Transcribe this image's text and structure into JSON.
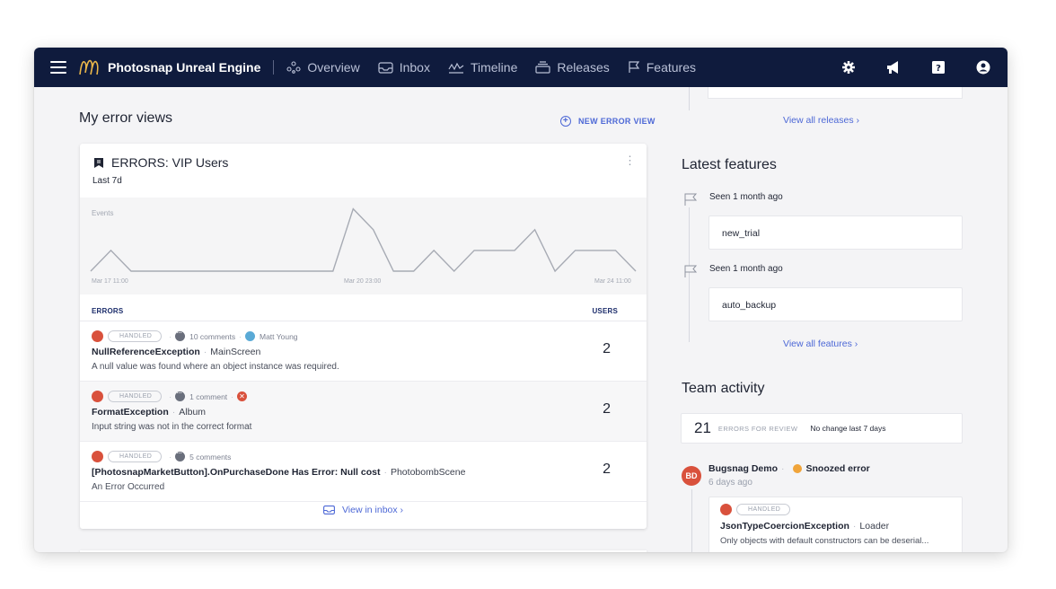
{
  "nav": {
    "project": "Photosnap Unreal Engine",
    "items": [
      {
        "label": "Overview",
        "icon": "overview-icon"
      },
      {
        "label": "Inbox",
        "icon": "inbox-icon"
      },
      {
        "label": "Timeline",
        "icon": "timeline-icon"
      },
      {
        "label": "Releases",
        "icon": "releases-icon"
      },
      {
        "label": "Features",
        "icon": "flag-icon"
      }
    ],
    "right_icons": [
      "gear-icon",
      "megaphone-icon",
      "help-icon",
      "account-icon"
    ]
  },
  "error_views": {
    "title": "My error views",
    "new_view_label": "NEW ERROR VIEW",
    "card": {
      "title": "ERRORS: VIP Users",
      "range": "Last 7d",
      "chart_label": "Events",
      "x_ticks": [
        "Mar 17 11:00",
        "Mar 20 23:00",
        "Mar 24 11:00"
      ],
      "col_errors": "ERRORS",
      "col_users": "USERS",
      "rows": [
        {
          "status": "HANDLED",
          "comments": "10 comments",
          "assignee": "Matt Young",
          "name": "NullReferenceException",
          "context": "MainScreen",
          "message": "A null value was found where an object instance was required.",
          "users": "2"
        },
        {
          "status": "HANDLED",
          "comments": "1 comment",
          "name": "FormatException",
          "context": "Album",
          "message": "Input string was not in the correct format",
          "users": "2"
        },
        {
          "status": "HANDLED",
          "comments": "5 comments",
          "name": "[PhotosnapMarketButton].OnPurchaseDone Has Error: Null cost",
          "context": "PhotobombScene",
          "message": "An Error Occurred",
          "users": "2"
        }
      ],
      "inbox_link": "View in inbox ›"
    }
  },
  "releases": {
    "view_all": "View all releases ›"
  },
  "features": {
    "title": "Latest features",
    "items": [
      {
        "seen": "Seen 1 month ago",
        "name": "new_trial"
      },
      {
        "seen": "Seen 1 month ago",
        "name": "auto_backup"
      }
    ],
    "view_all": "View all features ›"
  },
  "team_activity": {
    "title": "Team activity",
    "count": "21",
    "count_label": "ERRORS FOR REVIEW",
    "change": "No change last 7 days",
    "event": {
      "avatar": "BD",
      "user": "Bugsnag Demo",
      "action": "Snoozed error",
      "time": "6 days ago",
      "status": "HANDLED",
      "name": "JsonTypeCoercionException",
      "context": "Loader",
      "message": "Only objects with default constructors can be deserial..."
    }
  },
  "chart_data": {
    "type": "line",
    "title": "",
    "ylabel": "Events",
    "x_ticks": [
      "Mar 17 11:00",
      "Mar 20 23:00",
      "Mar 24 11:00"
    ],
    "series": [
      {
        "values": [
          0,
          1,
          0,
          0,
          0,
          0,
          0,
          0,
          0,
          0,
          0,
          0,
          0,
          3,
          2,
          0,
          0,
          1,
          0,
          1,
          1,
          1,
          2,
          0,
          1,
          1,
          1,
          0
        ]
      }
    ],
    "ylim": [
      0,
      3.2
    ]
  }
}
